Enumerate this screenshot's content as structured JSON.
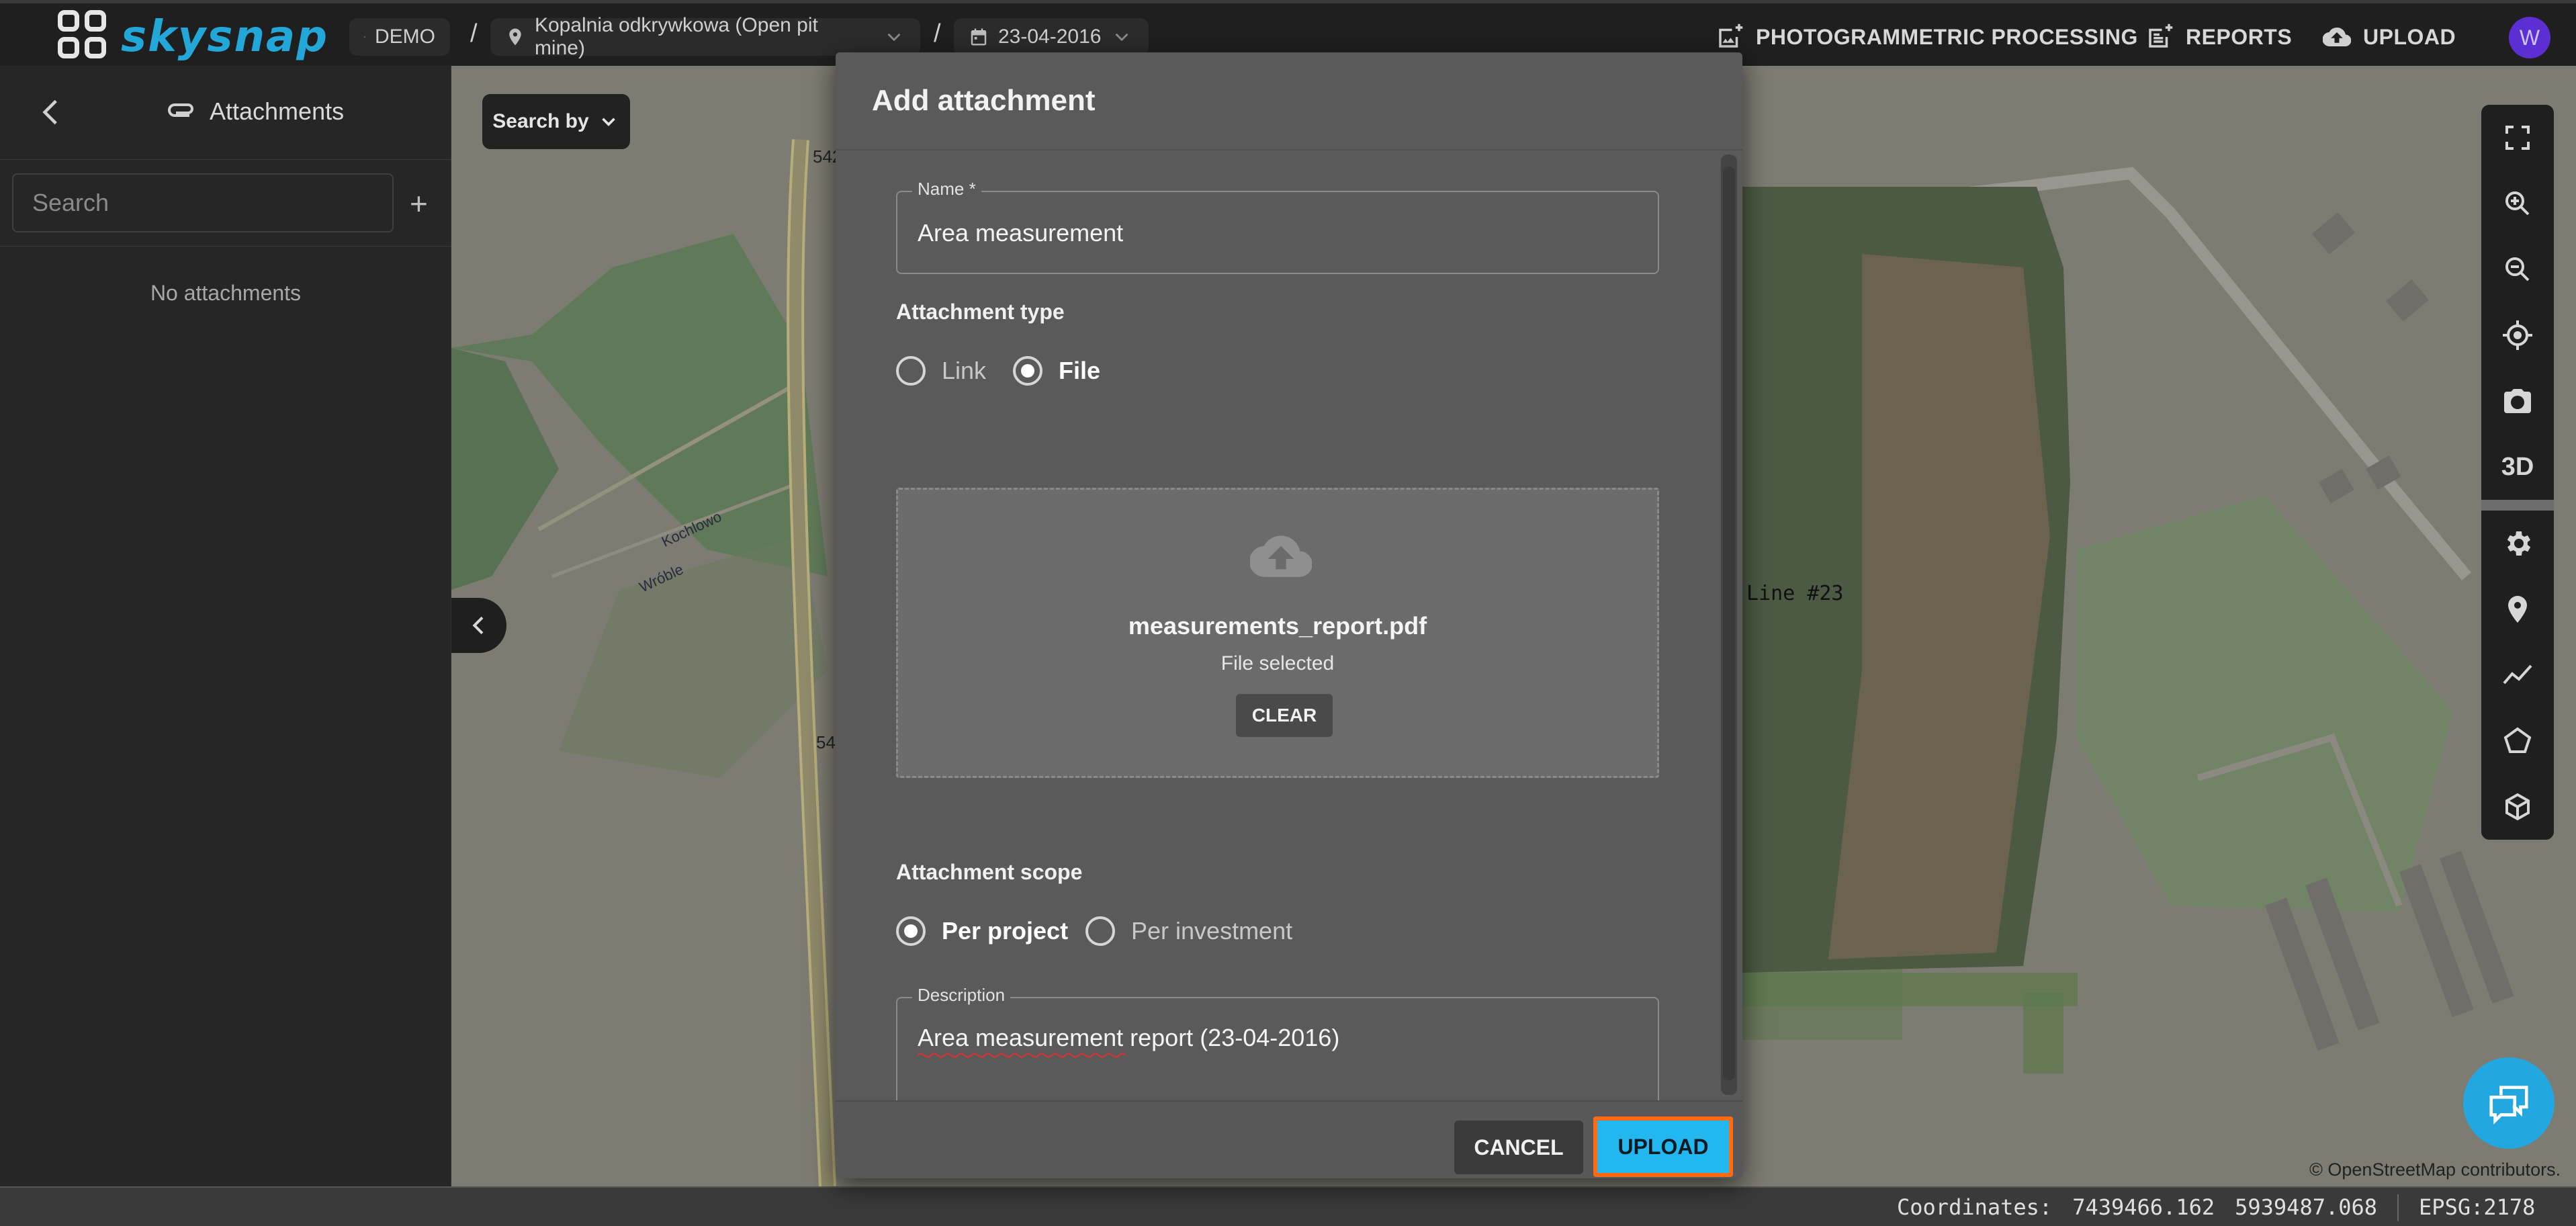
{
  "header": {
    "logo_text": "skysnap",
    "breadcrumbs": [
      {
        "label": "DEMO",
        "icon": "building-icon"
      },
      {
        "label": "Kopalnia odkrywkowa (Open pit mine)",
        "icon": "location-pin-icon"
      },
      {
        "label": "23-04-2016",
        "icon": "calendar-icon"
      }
    ],
    "separator": "/",
    "actions": [
      {
        "label": "PHOTOGRAMMETRIC PROCESSING",
        "icon": "image-add-icon"
      },
      {
        "label": "REPORTS",
        "icon": "report-add-icon"
      },
      {
        "label": "UPLOAD",
        "icon": "cloud-upload-icon"
      }
    ],
    "avatar_initial": "W"
  },
  "sidebar": {
    "title": "Attachments",
    "search_placeholder": "Search",
    "add_label": "+",
    "empty_text": "No attachments"
  },
  "map": {
    "search_by_label": "Search by",
    "line_label": "Line #23",
    "attribution": "© OpenStreetMap contributors.",
    "street_labels": [
      "542",
      "54",
      "Kochlowo",
      "Wróble"
    ],
    "toolbar_3d_label": "3D"
  },
  "status": {
    "coordinates_label": "Coordinates:",
    "x": "7439466.162",
    "y": "5939487.068",
    "epsg": "EPSG:2178"
  },
  "modal": {
    "title": "Add attachment",
    "name_label": "Name *",
    "name_value": "Area measurement",
    "type_label": "Attachment type",
    "type_options": [
      {
        "label": "Link",
        "selected": false
      },
      {
        "label": "File",
        "selected": true
      }
    ],
    "file_name": "measurements_report.pdf",
    "file_status": "File selected",
    "clear_label": "CLEAR",
    "scope_label": "Attachment scope",
    "scope_options": [
      {
        "label": "Per project",
        "selected": true
      },
      {
        "label": "Per investment",
        "selected": false
      }
    ],
    "description_label": "Description",
    "description_value": "Area measurement report (23-04-2016)",
    "cancel_label": "CANCEL",
    "upload_label": "UPLOAD"
  },
  "colors": {
    "accent": "#22a7e0",
    "highlight": "#ff6a13",
    "avatar": "#5b2fd1"
  }
}
